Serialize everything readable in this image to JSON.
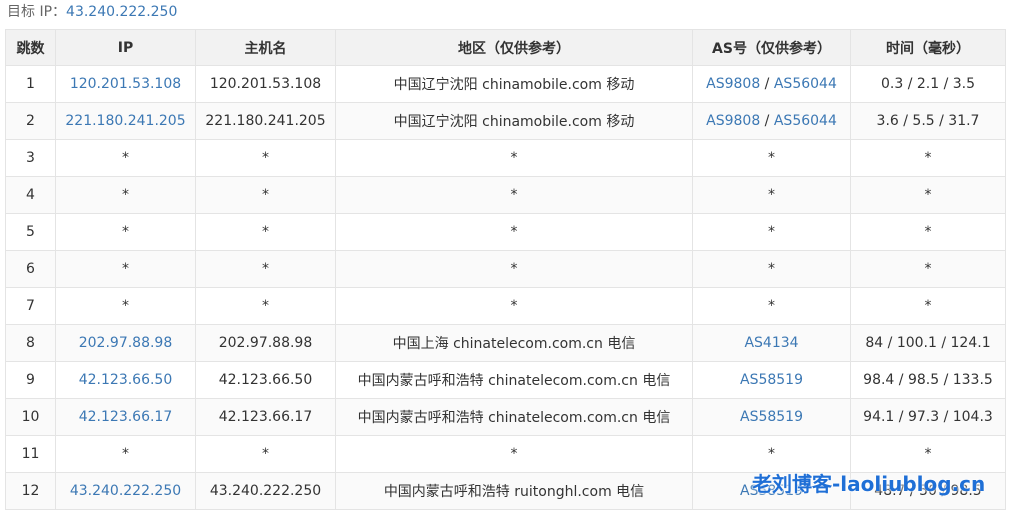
{
  "target": {
    "label": "目标 IP：",
    "ip": "43.240.222.250"
  },
  "columns": [
    "跳数",
    "IP",
    "主机名",
    "地区（仅供参考）",
    "AS号（仅供参考）",
    "时间（毫秒）"
  ],
  "rows": [
    {
      "hop": "1",
      "ip": "120.201.53.108",
      "host": "120.201.53.108",
      "region": "中国辽宁沈阳 chinamobile.com 移动",
      "as": [
        "AS9808",
        "AS56044"
      ],
      "time": "0.3 / 2.1 / 3.5"
    },
    {
      "hop": "2",
      "ip": "221.180.241.205",
      "host": "221.180.241.205",
      "region": "中国辽宁沈阳 chinamobile.com 移动",
      "as": [
        "AS9808",
        "AS56044"
      ],
      "time": "3.6 / 5.5 / 31.7"
    },
    {
      "hop": "3",
      "ip": "*",
      "host": "*",
      "region": "*",
      "as": [
        "*"
      ],
      "time": "*"
    },
    {
      "hop": "4",
      "ip": "*",
      "host": "*",
      "region": "*",
      "as": [
        "*"
      ],
      "time": "*"
    },
    {
      "hop": "5",
      "ip": "*",
      "host": "*",
      "region": "*",
      "as": [
        "*"
      ],
      "time": "*"
    },
    {
      "hop": "6",
      "ip": "*",
      "host": "*",
      "region": "*",
      "as": [
        "*"
      ],
      "time": "*"
    },
    {
      "hop": "7",
      "ip": "*",
      "host": "*",
      "region": "*",
      "as": [
        "*"
      ],
      "time": "*"
    },
    {
      "hop": "8",
      "ip": "202.97.88.98",
      "host": "202.97.88.98",
      "region": "中国上海 chinatelecom.com.cn 电信",
      "as": [
        "AS4134"
      ],
      "time": "84 / 100.1 / 124.1"
    },
    {
      "hop": "9",
      "ip": "42.123.66.50",
      "host": "42.123.66.50",
      "region": "中国内蒙古呼和浩特 chinatelecom.com.cn 电信",
      "as": [
        "AS58519"
      ],
      "time": "98.4 / 98.5 / 133.5"
    },
    {
      "hop": "10",
      "ip": "42.123.66.17",
      "host": "42.123.66.17",
      "region": "中国内蒙古呼和浩特 chinatelecom.com.cn 电信",
      "as": [
        "AS58519"
      ],
      "time": "94.1 / 97.3 / 104.3"
    },
    {
      "hop": "11",
      "ip": "*",
      "host": "*",
      "region": "*",
      "as": [
        "*"
      ],
      "time": "*"
    },
    {
      "hop": "12",
      "ip": "43.240.222.250",
      "host": "43.240.222.250",
      "region": "中国内蒙古呼和浩特 ruitonghl.com 电信",
      "as": [
        "AS58519"
      ],
      "time": "48.7 / 50 / 98.5"
    }
  ],
  "as_separator": " / ",
  "watermark": "老刘博客-laoliublog.cn",
  "colors": {
    "link": "#3c78b4",
    "header_bg": "#f2f2f2",
    "border": "#e4e4e4",
    "watermark": "#1f6fd6"
  }
}
